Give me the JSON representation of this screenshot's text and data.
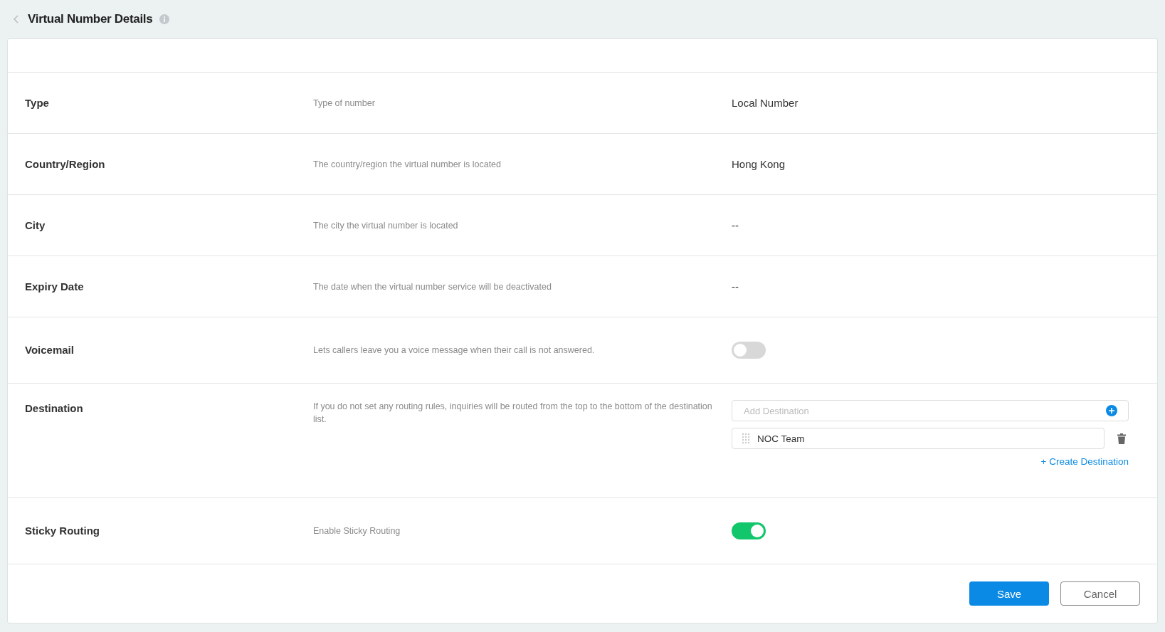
{
  "header": {
    "title": "Virtual Number Details"
  },
  "rows": [
    {
      "kind": "text",
      "label": "Type",
      "description": "Type of number",
      "value": "Local Number"
    },
    {
      "kind": "text",
      "label": "Country/Region",
      "description": "The country/region the virtual number is located",
      "value": "Hong Kong"
    },
    {
      "kind": "text",
      "label": "City",
      "description": "The city the virtual number is located",
      "value": "--"
    },
    {
      "kind": "text",
      "label": "Expiry Date",
      "description": "The date when the virtual number service will be deactivated",
      "value": "--"
    },
    {
      "kind": "toggle",
      "label": "Voicemail",
      "description": "Lets callers leave you a voice message when their call is not answered.",
      "on": false
    },
    {
      "kind": "destination",
      "label": "Destination",
      "description": "If you do not set any routing rules, inquiries will be routed from the top to the bottom of the destination list.",
      "placeholder": "Add Destination",
      "items": [
        "NOC Team"
      ],
      "link": "+ Create Destination"
    },
    {
      "kind": "toggle",
      "label": "Sticky Routing",
      "description": "Enable Sticky Routing",
      "on": true
    }
  ],
  "buttons": {
    "save": "Save",
    "cancel": "Cancel"
  }
}
